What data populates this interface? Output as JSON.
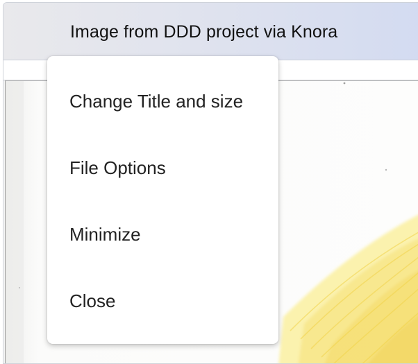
{
  "window": {
    "title": "Image from DDD project via Knora"
  },
  "context_menu": {
    "items": [
      {
        "label": "Change Title and size"
      },
      {
        "label": "File Options"
      },
      {
        "label": "Minimize"
      },
      {
        "label": "Close"
      }
    ]
  }
}
